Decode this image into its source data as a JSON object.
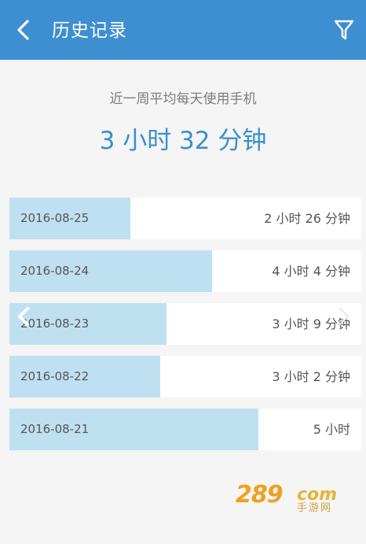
{
  "header": {
    "title": "历史记录",
    "back_icon": "chevron-left-icon",
    "filter_icon": "filter-icon",
    "bar_color": "#3d8fd1"
  },
  "summary": {
    "label": "近一周平均每天使用手机",
    "value": "3 小时 32 分钟",
    "value_color": "#3a8fcc"
  },
  "history": [
    {
      "date": "2016-08-25",
      "duration": "2 小时 26 分钟",
      "minutes": 146
    },
    {
      "date": "2016-08-24",
      "duration": "4 小时 4 分钟",
      "minutes": 244
    },
    {
      "date": "2016-08-23",
      "duration": "3 小时 9 分钟",
      "minutes": 189
    },
    {
      "date": "2016-08-22",
      "duration": "3 小时 2 分钟",
      "minutes": 182
    },
    {
      "date": "2016-08-21",
      "duration": "5 小时",
      "minutes": 300
    }
  ],
  "bar_fill_color": "#bfe0f1",
  "watermark": {
    "number": "289",
    "domain": "com",
    "subtitle": "手游网"
  }
}
